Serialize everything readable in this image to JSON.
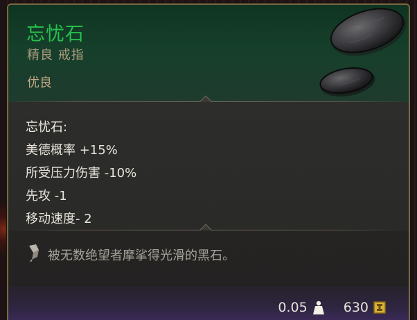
{
  "item": {
    "name": "忘忧石",
    "subtitle": "精良 戒指",
    "rarity": "优良",
    "name_color": "#27c24c"
  },
  "stats": {
    "header": "忘忧石:",
    "lines": [
      "美德概率 +15%",
      "所受压力伤害 -10%",
      "先攻 -1",
      "移动速度- 2"
    ]
  },
  "flavor": {
    "icon": "quill-icon",
    "text": "被无数绝望者摩挲得光滑的黑石。"
  },
  "footer": {
    "weight": "0.05",
    "weight_icon": "weight-icon",
    "value": "630",
    "value_icon": "gold-coin-icon"
  }
}
